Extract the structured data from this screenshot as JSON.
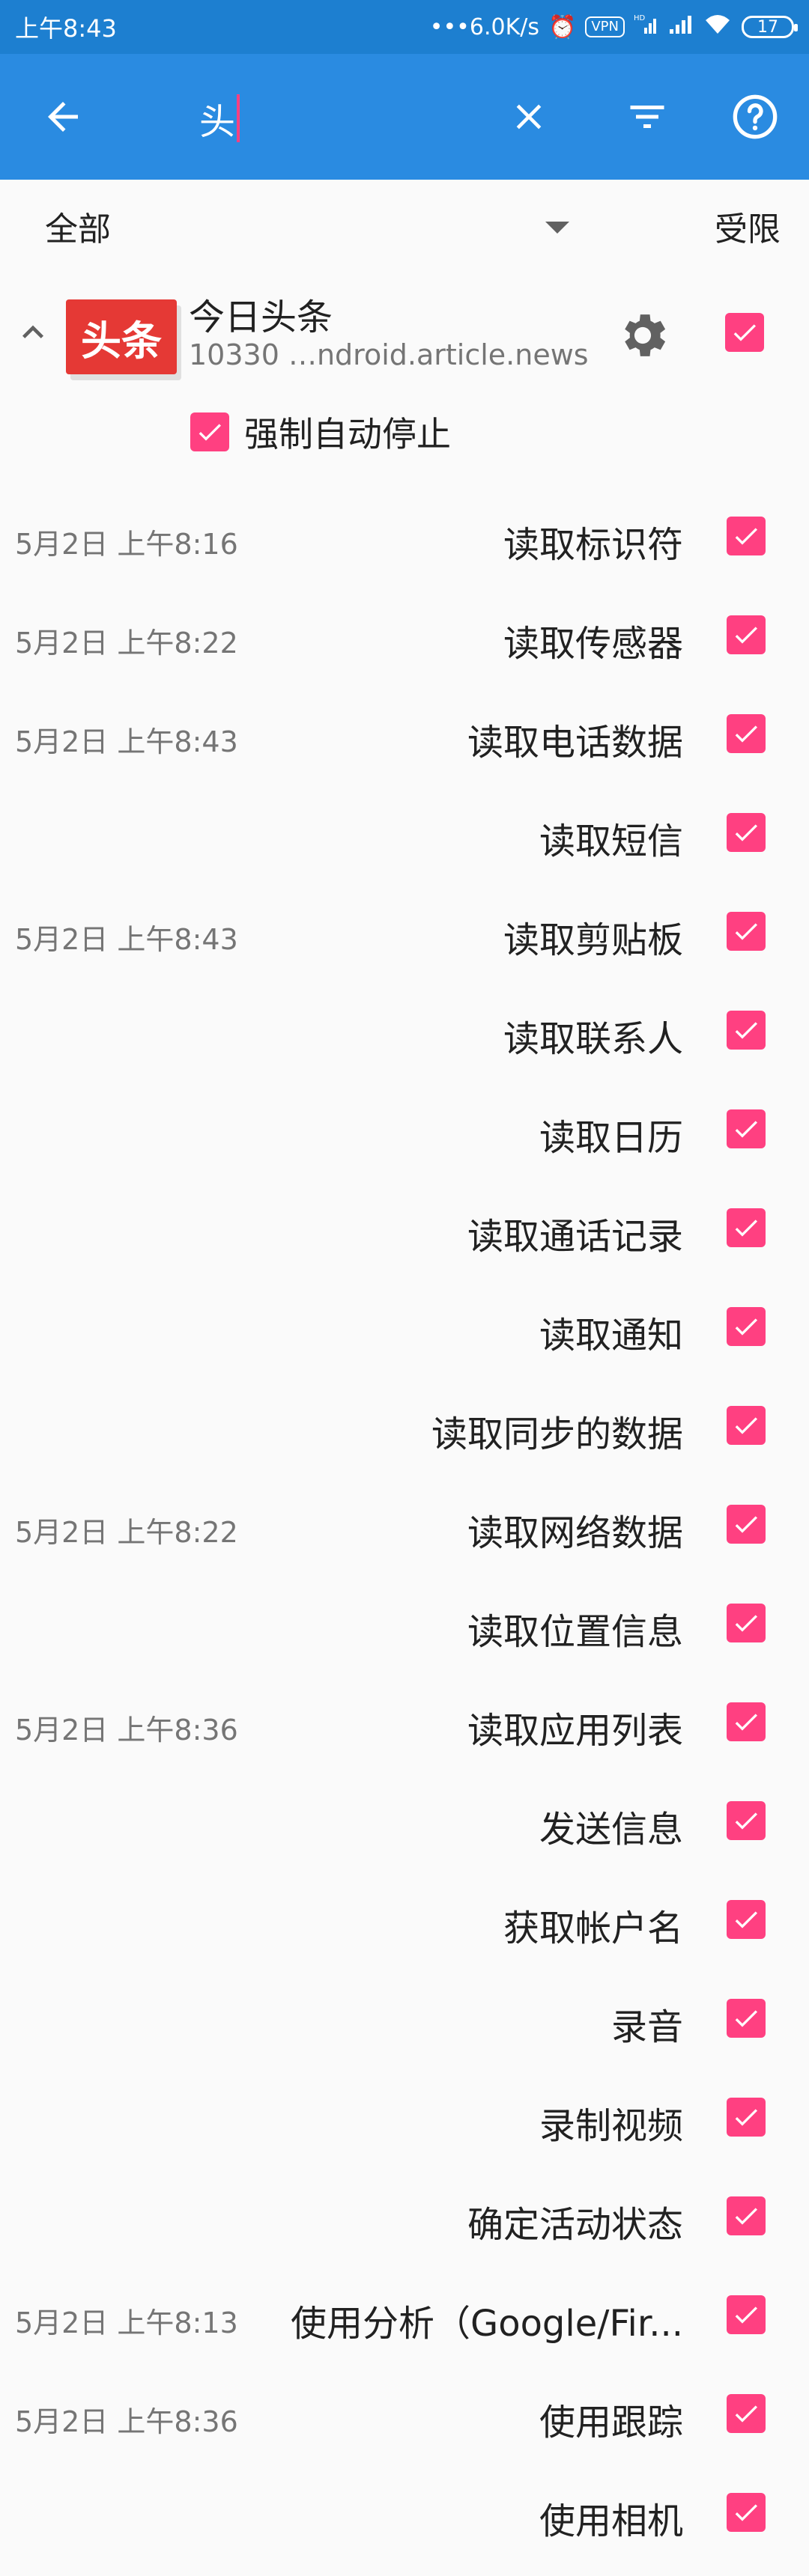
{
  "status_bar": {
    "time": "上午8:43",
    "net_speed": "•••6.0K/s",
    "vpn": "VPN",
    "hd": "HD",
    "battery": "17"
  },
  "toolbar": {
    "search_value": "头"
  },
  "filter": {
    "selected": "全部",
    "restricted_label": "受限"
  },
  "app": {
    "logo_text": "头条",
    "name": "今日头条",
    "package": "10330 …ndroid.article.news",
    "force_stop_label": "强制自动停止"
  },
  "permissions": [
    {
      "time": "5月2日 上午8:16",
      "name": "读取标识符"
    },
    {
      "time": "5月2日 上午8:22",
      "name": "读取传感器"
    },
    {
      "time": "5月2日 上午8:43",
      "name": "读取电话数据"
    },
    {
      "time": "",
      "name": "读取短信"
    },
    {
      "time": "5月2日 上午8:43",
      "name": "读取剪贴板"
    },
    {
      "time": "",
      "name": "读取联系人"
    },
    {
      "time": "",
      "name": "读取日历"
    },
    {
      "time": "",
      "name": "读取通话记录"
    },
    {
      "time": "",
      "name": "读取通知"
    },
    {
      "time": "",
      "name": "读取同步的数据"
    },
    {
      "time": "5月2日 上午8:22",
      "name": "读取网络数据"
    },
    {
      "time": "",
      "name": "读取位置信息"
    },
    {
      "time": "5月2日 上午8:36",
      "name": "读取应用列表"
    },
    {
      "time": "",
      "name": "发送信息"
    },
    {
      "time": "",
      "name": "获取帐户名"
    },
    {
      "time": "",
      "name": "录音"
    },
    {
      "time": "",
      "name": "录制视频"
    },
    {
      "time": "",
      "name": "确定活动状态"
    },
    {
      "time": "5月2日 上午8:13",
      "name": "使用分析（Google/Fir..."
    },
    {
      "time": "5月2日 上午8:36",
      "name": "使用跟踪"
    },
    {
      "time": "",
      "name": "使用相机"
    }
  ],
  "colors": {
    "toolbar": "#2a8be1",
    "statusbar": "#1d7fd0",
    "checkbox": "#ff4081"
  }
}
